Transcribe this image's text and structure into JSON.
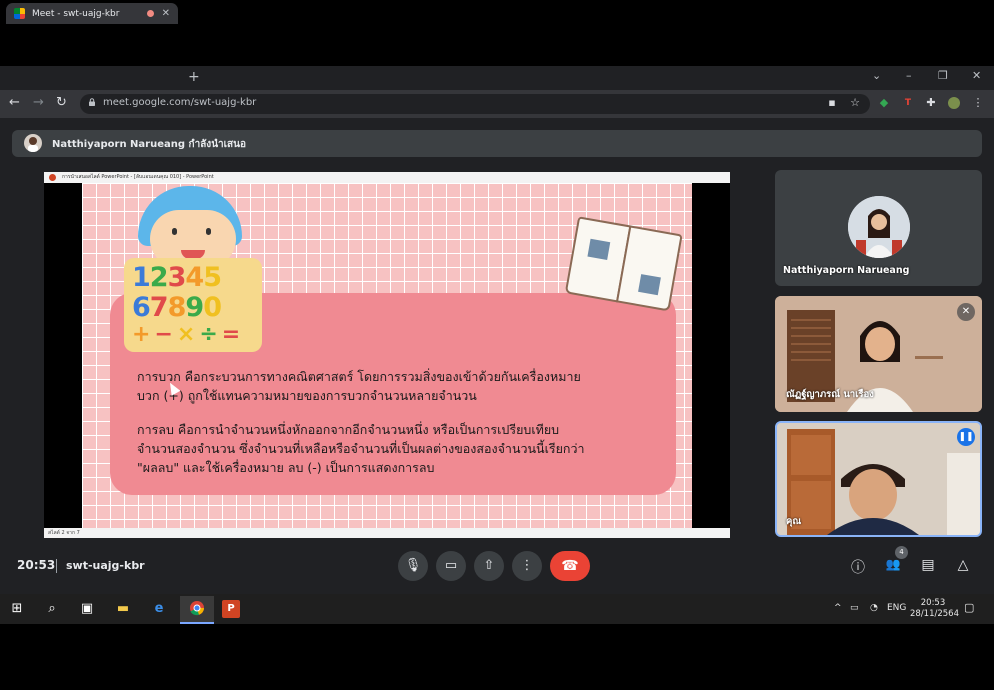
{
  "browser": {
    "tab_title": "Meet - swt-uajg-kbr",
    "url": "meet.google.com/swt-uajg-kbr",
    "window_controls": {
      "chevron": "⌄",
      "minimize": "–",
      "restore": "❐",
      "close": "✕"
    },
    "icons": {
      "back": "←",
      "forward": "→",
      "reload": "↻",
      "new_tab": "+",
      "tab_close": "✕"
    }
  },
  "banner": {
    "presenter_text": "Natthiyaporn Narueang กำลังนำเสนอ"
  },
  "presentation": {
    "window_title": "การนำเสนอสไลด์ PowerPoint - [ลับแอนเดนคุณ 010] - PowerPoint",
    "status_text": "สไลด์ 2 จาก 7",
    "numbers_row1": [
      "1",
      "2",
      "3",
      "4",
      "5"
    ],
    "numbers_row2": [
      "6",
      "7",
      "8",
      "9",
      "0"
    ],
    "numbers_row3": [
      "+",
      "−",
      "×",
      "÷",
      "="
    ],
    "paragraph1_line1": "การบวก คือกระบวนการทางคณิตศาสตร์   โดยการรวมสิ่งของเข้าด้วยกันเครื่องหมาย",
    "paragraph1_line2": "บวก (+)  ถูกใช้แทนความหมายของการบวกจำนวนหลายจำนวน",
    "paragraph2_line1": "การลบ คือการนำจำนวนหนึ่งหักออกจากอีกจำนวนหนึ่ง หรือเป็นการเปรียบเทียบ",
    "paragraph2_line2": "จำนวนสองจำนวน ซึ่งจำนวนที่เหลือหรือจำนวนที่เป็นผลต่างของสองจำนวนนี้เรียกว่า",
    "paragraph2_line3": "\"ผลลบ\" และใช้เครื่องหมาย ลบ (-) เป็นการแสดงการลบ"
  },
  "participants": [
    {
      "name": "Natthiyaporn Narueang"
    },
    {
      "name": "ณัฏฐ์ญาภรณ์ นาเรือง"
    },
    {
      "name": "คุณ"
    }
  ],
  "meeting": {
    "time": "20:53",
    "code": "swt-uajg-kbr",
    "participant_count": "4",
    "controls": {
      "mic": "🎙",
      "camera": "▭",
      "present": "⇧",
      "more": "⋮",
      "hangup": "☎",
      "info": "ⓘ",
      "people": "👥",
      "chat": "▤",
      "activities": "△"
    }
  },
  "taskbar": {
    "language": "ENG",
    "time": "20:53",
    "date": "28/11/2564"
  },
  "colors": {
    "meet_bg": "#202124",
    "hangup": "#ea4335",
    "slide_pink": "#f7c2c2",
    "card_pink": "#f08a92",
    "active_tile_border": "#8ab4f8"
  }
}
